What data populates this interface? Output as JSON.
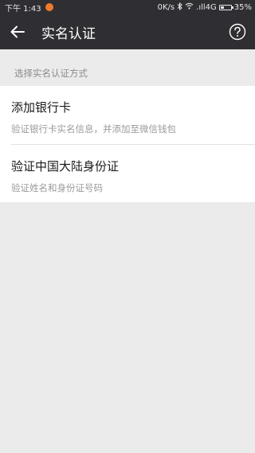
{
  "status_bar": {
    "time": "下午 1:43",
    "speed": "0K/s",
    "network": ".ıll4G",
    "battery": "35%",
    "battery_level": 0.35
  },
  "app_bar": {
    "back_icon": "back-arrow-icon",
    "title": "实名认证",
    "help_icon": "help-circle-icon"
  },
  "section_header": "选择实名认证方式",
  "options": [
    {
      "title": "添加银行卡",
      "subtitle": "验证银行卡实名信息，并添加至微信钱包"
    },
    {
      "title": "验证中国大陆身份证",
      "subtitle": "验证姓名和身份证号码"
    }
  ],
  "colors": {
    "app_bar": "#2f2f33",
    "background": "#ebebeb",
    "notification": "#ef7b2a"
  }
}
